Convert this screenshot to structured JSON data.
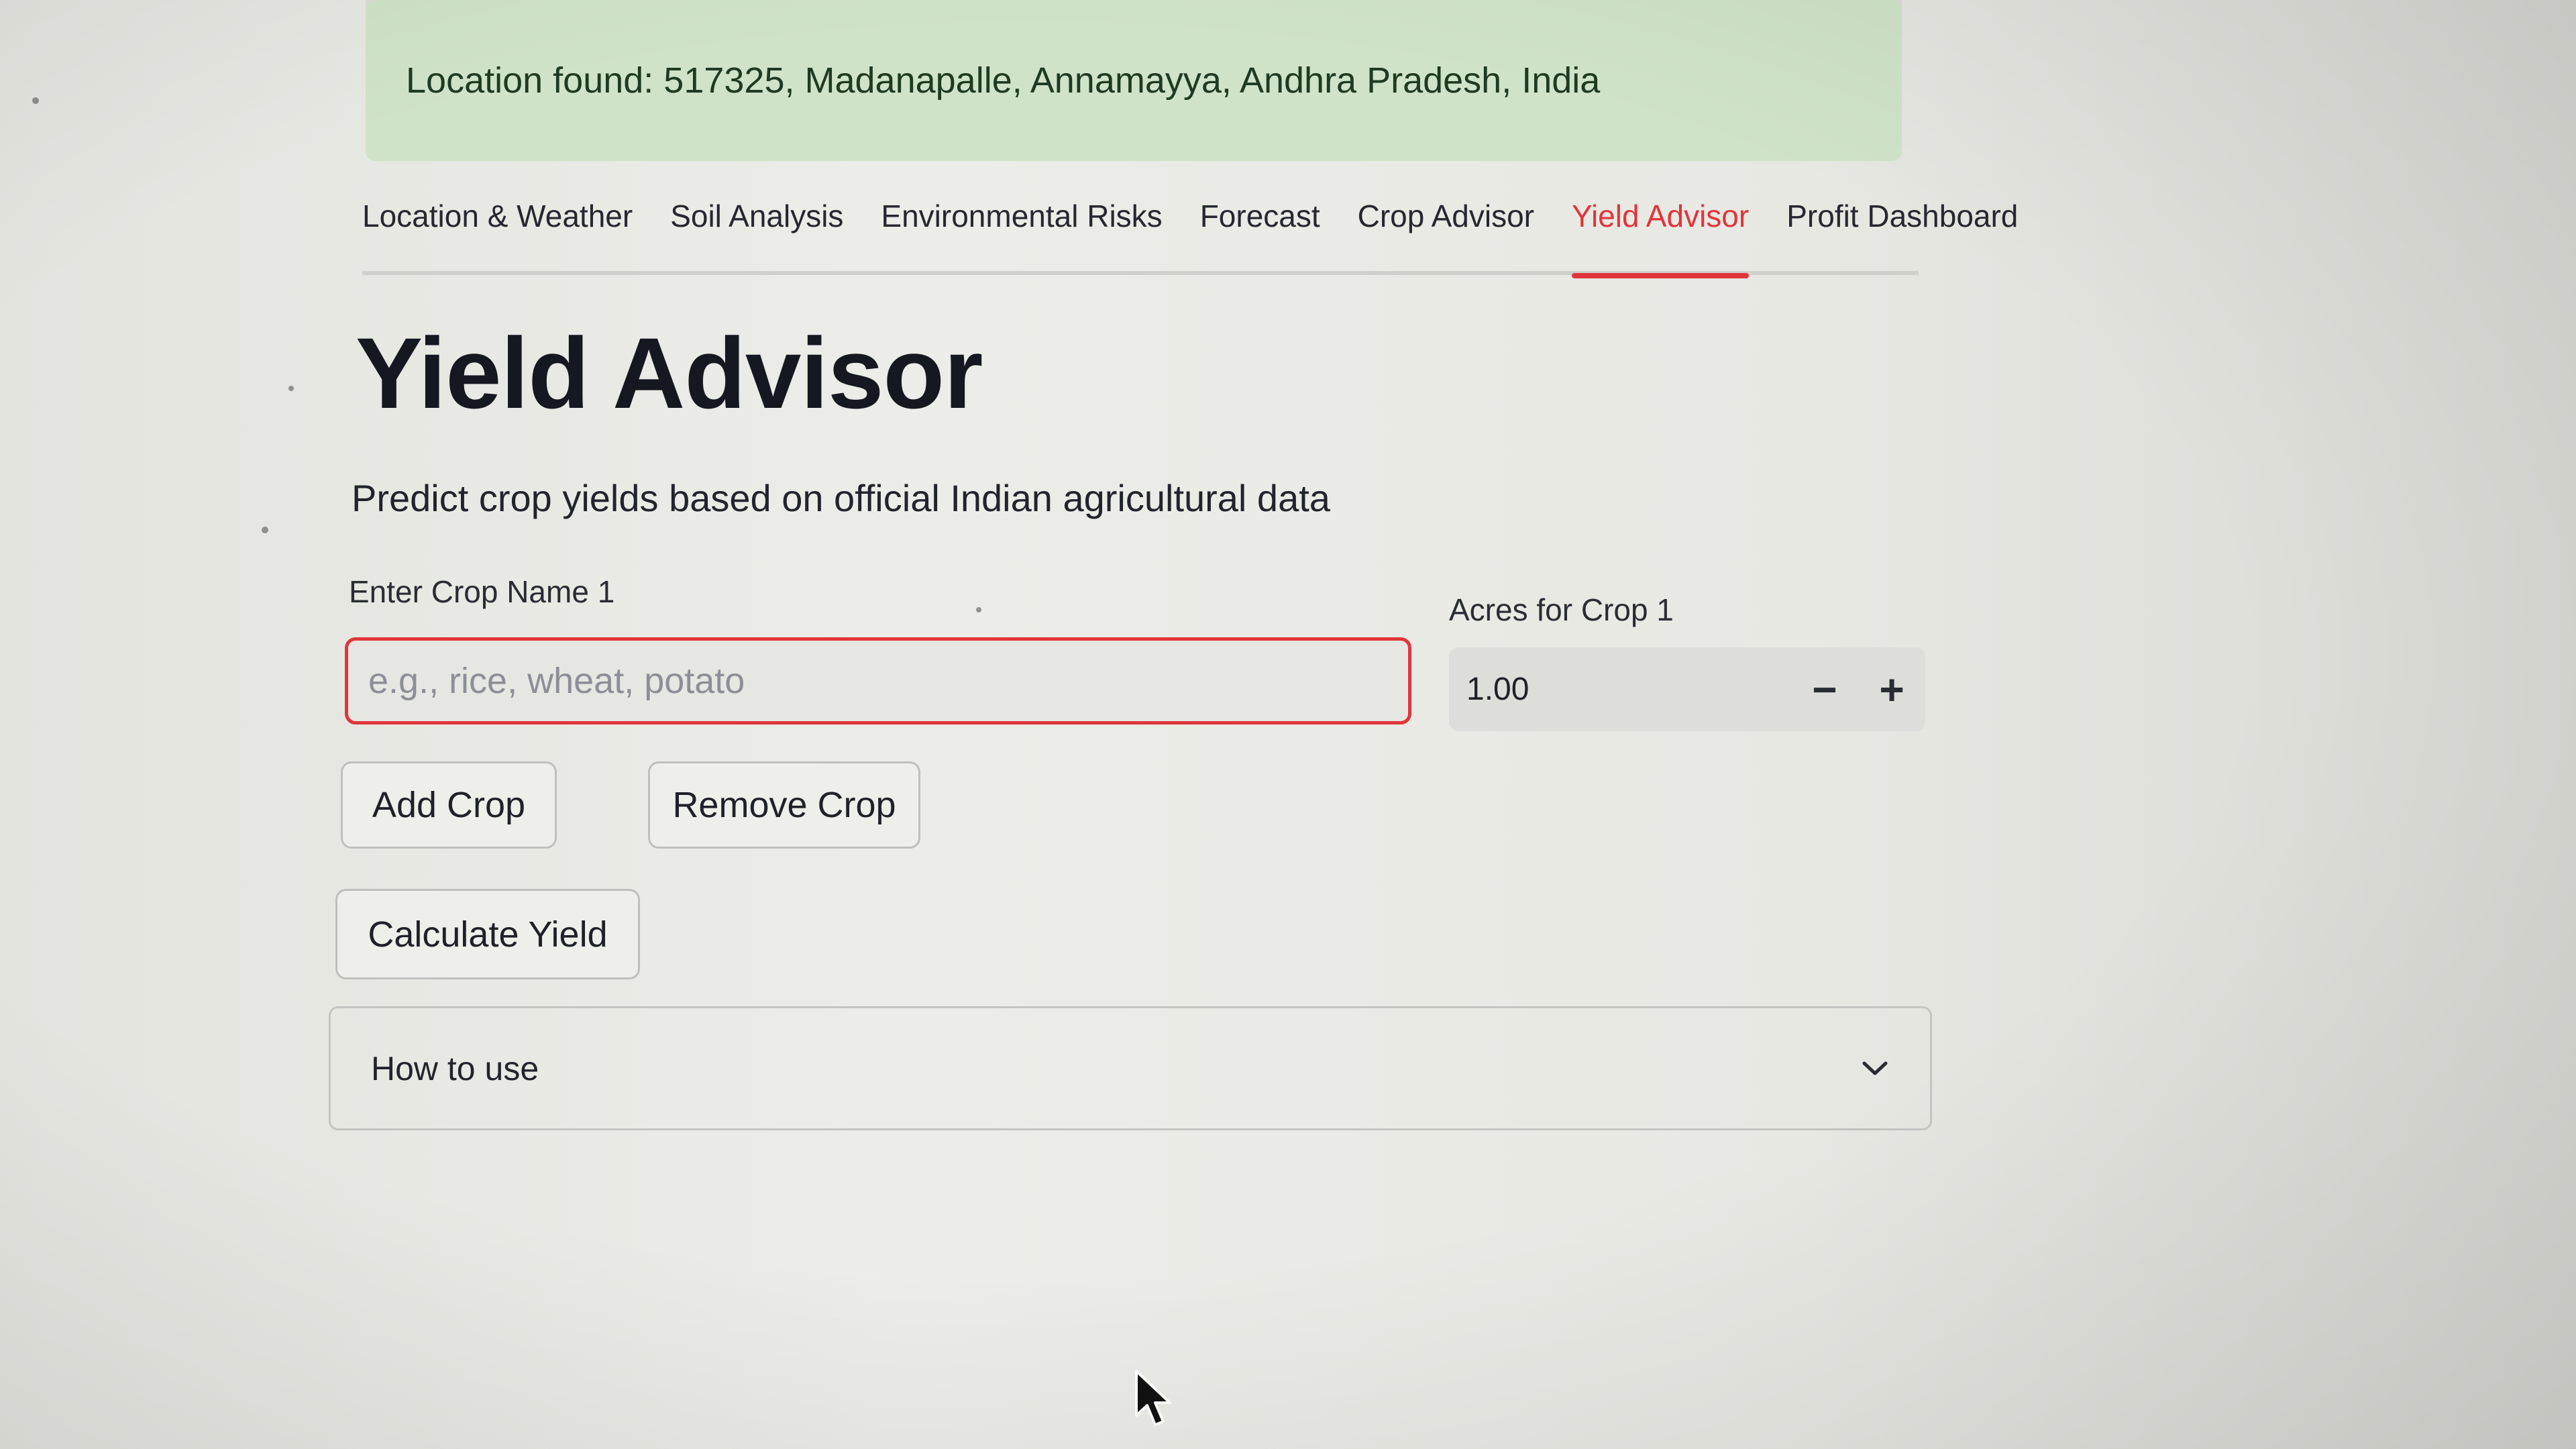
{
  "alert": {
    "text": "Location found: 517325, Madanapalle, Annamayya, Andhra Pradesh, India"
  },
  "tabs": [
    {
      "label": "Location & Weather",
      "active": false
    },
    {
      "label": "Soil Analysis",
      "active": false
    },
    {
      "label": "Environmental Risks",
      "active": false
    },
    {
      "label": "Forecast",
      "active": false
    },
    {
      "label": "Crop Advisor",
      "active": false
    },
    {
      "label": "Yield Advisor",
      "active": true
    },
    {
      "label": "Profit Dashboard",
      "active": false
    }
  ],
  "main": {
    "title": "Yield Advisor",
    "subtitle": "Predict crop yields based on official Indian agricultural data"
  },
  "form": {
    "crop_label": "Enter Crop Name 1",
    "crop_placeholder": "e.g., rice, wheat, potato",
    "crop_value": "",
    "acres_label": "Acres for Crop 1",
    "acres_value": "1.00",
    "minus_symbol": "−",
    "plus_symbol": "+"
  },
  "buttons": {
    "add_crop": "Add Crop",
    "remove_crop": "Remove Crop",
    "calculate": "Calculate Yield"
  },
  "expander": {
    "label": "How to use"
  },
  "colors": {
    "accent": "#e0353a",
    "alert_bg": "#cfe3c8",
    "background": "#ebebe7"
  },
  "icons": {
    "expander": "chevron-down-icon",
    "cursor": "mouse-pointer-icon"
  }
}
